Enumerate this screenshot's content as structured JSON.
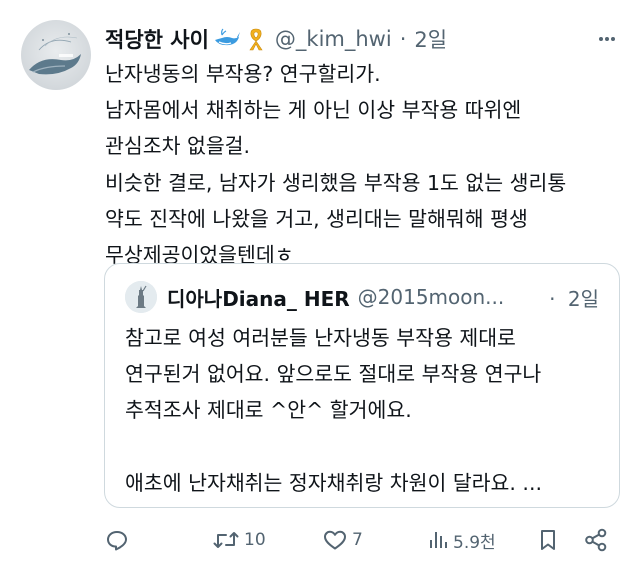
{
  "tweet": {
    "author_name": "적당한 사이",
    "handle": "@_kim_hwi",
    "separator": "·",
    "time": "2일",
    "text": "난자냉동의 부작용? 연구할리가.\n남자몸에서 채취하는 게 아닌 이상 부작용 따위엔\n관심조차 없을걸.\n비슷한 결로, 남자가 생리했음 부작용 1도 없는 생리통\n약도 진작에 나왔을 거고, 생리대는 말해뭐해 평생\n무상제공이었을텐데ㅎ",
    "icons": [
      "whale-icon",
      "ribbon-icon",
      "more-icon"
    ]
  },
  "quote": {
    "author_name": "디아나Diana_ HER",
    "handle": "@2015moon...",
    "separator": "·",
    "time": "2일",
    "text": "참고로 여성 여러분들 난자냉동 부작용 제대로\n연구된거 없어요. 앞으로도 절대로 부작용 연구나\n추적조사 제대로 ^안^ 할거에요.\n\n애초에 난자채취는 정자채취랑 차원이 달라요. ..."
  },
  "actions": {
    "reply_count": "",
    "retweet_count": "10",
    "like_count": "7",
    "views_count": "5.9천"
  },
  "colors": {
    "text": "#0f1419",
    "secondary": "#536471",
    "border": "#cfd9de"
  }
}
